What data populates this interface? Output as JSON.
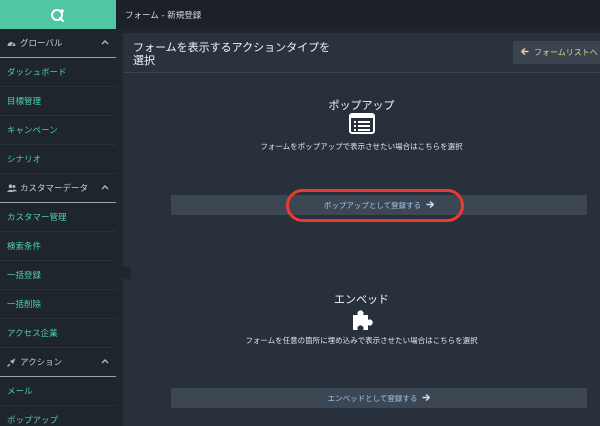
{
  "topbar": {
    "title": "フォーム - 新規登録"
  },
  "sidebar": {
    "sections": [
      {
        "label": "グローバル",
        "icon": "gauge-icon",
        "items": [
          "ダッシュボード",
          "目標管理",
          "キャンペーン",
          "シナリオ"
        ]
      },
      {
        "label": "カスタマーデータ",
        "icon": "users-icon",
        "items": [
          "カスタマー管理",
          "検索条件",
          "一括登録",
          "一括削除",
          "アクセス企業"
        ]
      },
      {
        "label": "アクション",
        "icon": "rocket-icon",
        "items": [
          "メール",
          "ポップアップ"
        ]
      }
    ]
  },
  "panel": {
    "title": "フォームを表示するアクションタイプを選択",
    "back_button": "フォームリストへ"
  },
  "popup": {
    "heading": "ポップアップ",
    "description": "フォームをポップアップで表示させたい場合はこちらを選択",
    "button": "ポップアップとして登録する",
    "icon": "list-window-icon"
  },
  "embed": {
    "heading": "エンベッド",
    "description": "フォームを任意の箇所に埋め込みで表示させたい場合はこちらを選択",
    "button": "エンベッドとして登録する",
    "icon": "puzzle-icon"
  },
  "colors": {
    "accent": "#4ec7a2",
    "highlight": "#ea3b2f",
    "back": "#e6d58a",
    "button_text": "#9ec7f2"
  }
}
